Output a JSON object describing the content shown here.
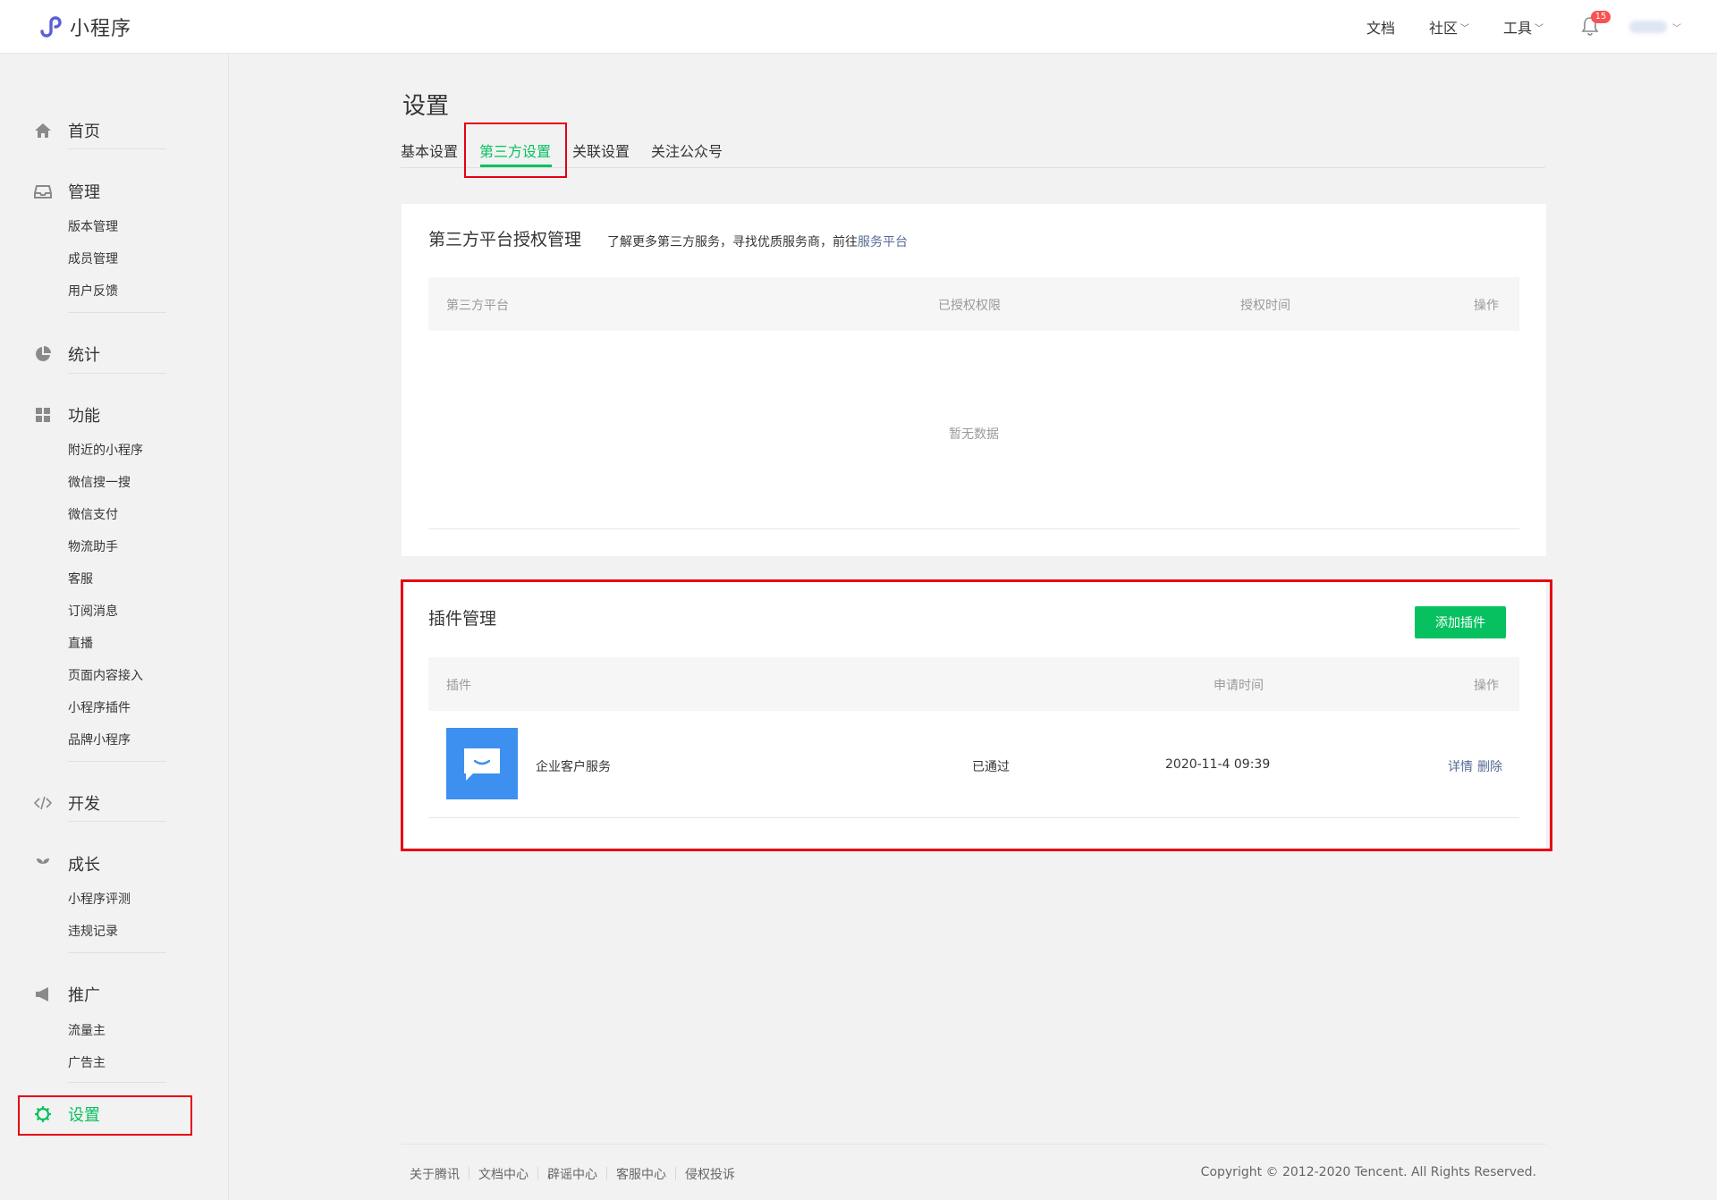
{
  "header": {
    "logo_text": "小程序",
    "nav": [
      {
        "label": "文档",
        "has_dropdown": false
      },
      {
        "label": "社区",
        "has_dropdown": true
      },
      {
        "label": "工具",
        "has_dropdown": true
      }
    ],
    "notification_count": "15",
    "chevron": "﹀"
  },
  "sidebar": {
    "home": "首页",
    "manage": "管理",
    "manage_items": [
      "版本管理",
      "成员管理",
      "用户反馈"
    ],
    "stats": "统计",
    "features": "功能",
    "features_items": [
      "附近的小程序",
      "微信搜一搜",
      "微信支付",
      "物流助手",
      "客服",
      "订阅消息",
      "直播",
      "页面内容接入",
      "小程序插件",
      "品牌小程序"
    ],
    "develop": "开发",
    "growth": "成长",
    "growth_items": [
      "小程序评测",
      "违规记录"
    ],
    "promotion": "推广",
    "promotion_items": [
      "流量主",
      "广告主"
    ],
    "settings": "设置",
    "active": "设置",
    "accent_color": "#07c160"
  },
  "main": {
    "page_title": "设置",
    "tabs": [
      "基本设置",
      "第三方设置",
      "关联设置",
      "关注公众号"
    ],
    "active_tab": "第三方设置",
    "third_party": {
      "title": "第三方平台授权管理",
      "desc_prefix": "了解更多第三方服务，寻找优质服务商，前往",
      "desc_link": "服务平台",
      "columns": [
        "第三方平台",
        "已授权权限",
        "授权时间",
        "操作"
      ],
      "empty_text": "暂无数据"
    },
    "plugins": {
      "title": "插件管理",
      "add_button": "添加插件",
      "columns": [
        "插件",
        "申请时间",
        "操作"
      ],
      "rows": [
        {
          "icon": "chat-bubble-icon",
          "name": "企业客户服务",
          "status": "已通过",
          "apply_time": "2020-11-4 09:39",
          "actions": [
            "详情",
            "删除"
          ]
        }
      ]
    }
  },
  "footer": {
    "links": [
      "关于腾讯",
      "文档中心",
      "辟谣中心",
      "客服中心",
      "侵权投诉"
    ],
    "copyright": "Copyright © 2012-2020 Tencent. All Rights Reserved."
  },
  "colors": {
    "highlight_box": "#e60012",
    "link": "#576b95",
    "plugin_icon_bg": "#3d8ff0"
  }
}
